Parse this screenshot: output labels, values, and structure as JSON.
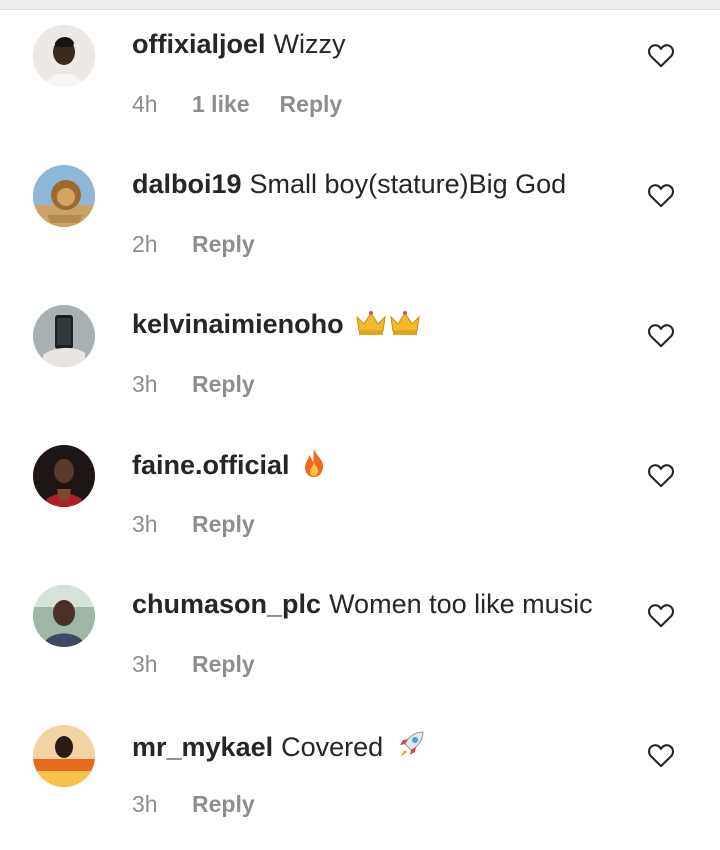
{
  "comments": [
    {
      "username": "offixialjoel",
      "text": "Wizzy",
      "emoji": "",
      "time": "4h",
      "likes": "1 like",
      "reply": "Reply",
      "avatar_color": "#d9d2cc"
    },
    {
      "username": "dalboi19",
      "text": "Small boy(stature)Big God",
      "emoji": "",
      "time": "2h",
      "likes": "",
      "reply": "Reply",
      "avatar_color": "#7fa7c9"
    },
    {
      "username": "kelvinaimienoho",
      "text": "",
      "emoji": "crown-emoji x2",
      "time": "3h",
      "likes": "",
      "reply": "Reply",
      "avatar_color": "#8f9a9e"
    },
    {
      "username": "faine.official",
      "text": "",
      "emoji": "fire-emoji",
      "time": "3h",
      "likes": "",
      "reply": "Reply",
      "avatar_color": "#3a2a26"
    },
    {
      "username": "chumason_plc",
      "text": "Women too like music",
      "emoji": "",
      "time": "3h",
      "likes": "",
      "reply": "Reply",
      "avatar_color": "#5b6a5e"
    },
    {
      "username": "mr_mykael",
      "text": "Covered",
      "emoji": "rocket-emoji",
      "time": "3h",
      "likes": "",
      "reply": "Reply",
      "avatar_color": "#e8b46a"
    }
  ],
  "colors": {
    "text": "#262626",
    "meta": "#8e8e8e",
    "divider": "#dedede"
  }
}
